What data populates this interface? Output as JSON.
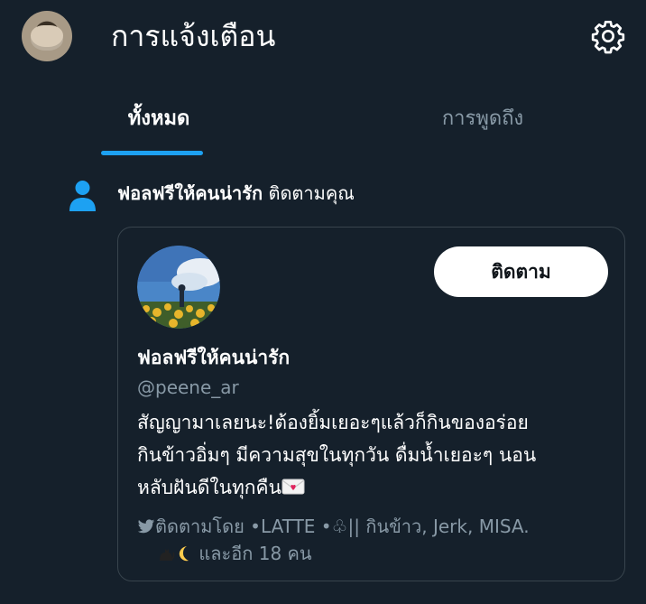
{
  "header": {
    "title": "การแจ้งเตือน",
    "settings_icon": "gear-icon"
  },
  "tabs": [
    {
      "label": "ทั้งหมด",
      "active": true
    },
    {
      "label": "การพูดถึง",
      "active": false
    }
  ],
  "notification": {
    "icon": "person-icon",
    "actor": "ฟอลฟรีให้คนน่ารัก",
    "action": " ติดตามคุณ",
    "card": {
      "follow_label": "ติดตาม",
      "name": "ฟอลฟรีให้คนน่ารัก",
      "handle": "@peene_ar",
      "bio_lines": [
        "สัญญามาเลยนะ!ต้องยิ้มเยอะๆแล้วก็กินของอร่อย",
        "กินข้าวอิ่มๆ มีความสุขในทุกวัน ดื่มน้ำเยอะๆ นอน",
        "หลับฝันดีในทุกคืน"
      ],
      "followed_by_line1": "ติดตามโดย •LATTE •♧|| กินข้าว, Jerk, MISA.",
      "followed_by_line2": " และอีก 18 คน"
    }
  },
  "colors": {
    "background": "#15202b",
    "accent": "#1da1f2",
    "secondary_text": "#8899a6",
    "border": "#38444d"
  }
}
